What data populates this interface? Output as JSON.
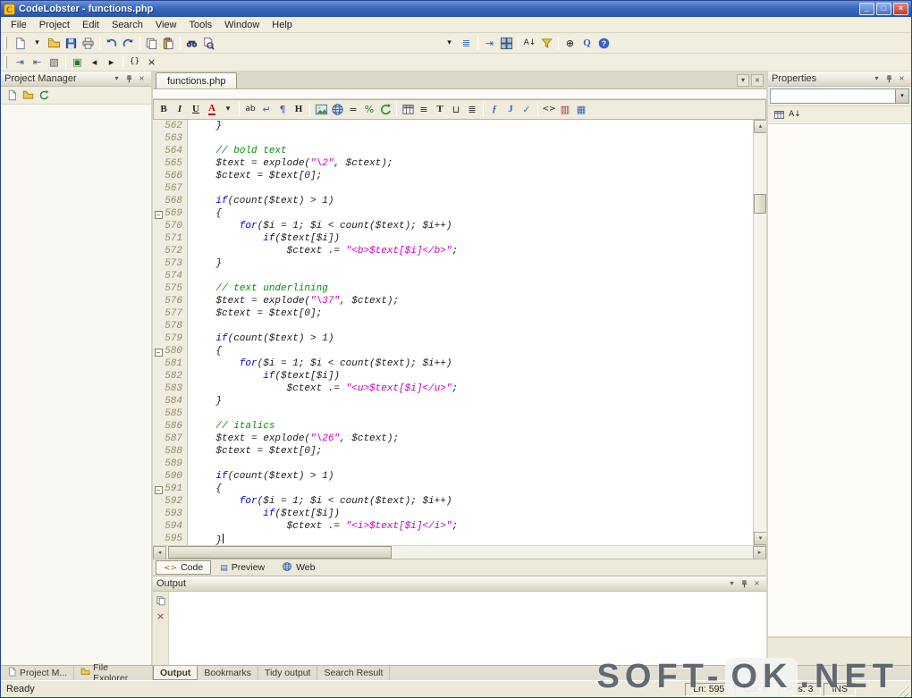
{
  "window": {
    "title": "CodeLobster - functions.php"
  },
  "titlebar": {
    "buttons": [
      {
        "name": "minimize-button",
        "glyph": "_"
      },
      {
        "name": "maximize-button",
        "glyph": "□"
      },
      {
        "name": "close-button",
        "glyph": "×"
      }
    ]
  },
  "menu": [
    "File",
    "Project",
    "Edit",
    "Search",
    "View",
    "Tools",
    "Window",
    "Help"
  ],
  "panel_buttons": [
    {
      "name": "panel-menu-icon",
      "icon": "chevron"
    },
    {
      "name": "panel-pin-icon",
      "icon": "pin"
    },
    {
      "name": "panel-close-icon",
      "icon": "close"
    }
  ],
  "toolbar_main": [
    {
      "grip": true
    },
    {
      "name": "new-file-icon",
      "icon": "page"
    },
    {
      "name": "new-file-dropdown-icon",
      "glyph": "▾",
      "gcls": "small"
    },
    {
      "name": "open-file-icon",
      "icon": "folder"
    },
    {
      "name": "save-icon",
      "icon": "disk"
    },
    {
      "name": "print-icon",
      "icon": "printer"
    },
    {
      "sep": true
    },
    {
      "name": "undo-icon",
      "icon": "undo"
    },
    {
      "name": "redo-icon",
      "icon": "redo"
    },
    {
      "sep": true
    },
    {
      "name": "copy-icon",
      "icon": "copy"
    },
    {
      "name": "paste-icon",
      "icon": "paste"
    },
    {
      "sep": true
    },
    {
      "name": "find-icon",
      "icon": "find"
    },
    {
      "name": "find-in-files-icon",
      "icon": "findfiles"
    },
    {
      "space": true
    },
    {
      "name": "toolbar-options-icon",
      "glyph": "▾",
      "gcls": "small"
    },
    {
      "name": "members-list-icon",
      "glyph": "≣",
      "color": "#3a62c0"
    },
    {
      "sep": true
    },
    {
      "name": "format-code-icon",
      "glyph": "⇥",
      "color": "#3a62c0"
    },
    {
      "name": "windows-icon",
      "icon": "windows"
    },
    {
      "sep": true
    },
    {
      "name": "sort-ascending-icon",
      "glyph": "A↓",
      "gcls": "small"
    },
    {
      "name": "filter-icon",
      "icon": "funnel"
    },
    {
      "sep": true
    },
    {
      "name": "zoom-icon",
      "glyph": "⊕"
    },
    {
      "name": "quick-search-icon",
      "glyph": "Q",
      "gcls": "fb",
      "color": "#3a62c0"
    },
    {
      "name": "help-icon",
      "icon": "help"
    }
  ],
  "toolbar_edit": [
    {
      "grip": true
    },
    {
      "name": "increase-indent-icon",
      "glyph": "⇥",
      "color": "#335a9a"
    },
    {
      "name": "decrease-indent-icon",
      "glyph": "⇤",
      "color": "#335a9a"
    },
    {
      "name": "comment-icon",
      "glyph": "▧",
      "color": "#556"
    },
    {
      "sep": true
    },
    {
      "name": "toggle-bookmark-icon",
      "glyph": "▣",
      "color": "#2a7a2a"
    },
    {
      "name": "prev-bookmark-icon",
      "glyph": "◂"
    },
    {
      "name": "next-bookmark-icon",
      "glyph": "▸"
    },
    {
      "sep": true
    },
    {
      "name": "match-brace-icon",
      "glyph": "{}",
      "gcls": "small"
    },
    {
      "name": "close-toolbar-icon",
      "glyph": "×"
    }
  ],
  "project_manager": {
    "title": "Project Manager",
    "toolbar": [
      {
        "name": "new-project-icon",
        "icon": "page"
      },
      {
        "name": "open-folder-icon",
        "icon": "folder"
      },
      {
        "name": "refresh-project-icon",
        "icon": "refresh"
      }
    ]
  },
  "properties": {
    "title": "Properties",
    "selector_value": "",
    "toolbar": [
      {
        "name": "categorized-icon",
        "icon": "table"
      },
      {
        "name": "sort-alphabetical-icon",
        "glyph": "A↓",
        "gcls": "small"
      }
    ]
  },
  "output": {
    "title": "Output",
    "strip": [
      {
        "name": "copy-output-icon",
        "icon": "copy"
      },
      {
        "name": "clear-output-icon",
        "glyph": "×",
        "color": "#a03030"
      }
    ]
  },
  "editor": {
    "tab": "functions.php",
    "tab_buttons": [
      {
        "name": "tab-scroll-icon",
        "icon": "chevron"
      },
      {
        "name": "tab-close-icon",
        "icon": "close"
      }
    ],
    "syntax_colors": {
      "p": "#1a1a1a",
      "k": "#0000cc",
      "c": "#009000",
      "s": "#c800c8"
    },
    "format_toolbar": [
      {
        "name": "bold-icon",
        "glyph": "B",
        "gcls": "fb"
      },
      {
        "name": "italic-icon",
        "glyph": "I",
        "gcls": "fi"
      },
      {
        "name": "underline-icon",
        "glyph": "U",
        "gcls": "fu"
      },
      {
        "name": "font-color-icon",
        "glyph": "A",
        "gcls": "fA"
      },
      {
        "name": "font-color-dropdown-icon",
        "glyph": "▾",
        "gcls": "small"
      },
      {
        "sep": true
      },
      {
        "name": "abbr-icon",
        "glyph": "ab",
        "gcls": "small"
      },
      {
        "name": "line-break-icon",
        "glyph": "↵",
        "color": "#3a62c0"
      },
      {
        "name": "paragraph-icon",
        "glyph": "¶",
        "color": "#3a62c0"
      },
      {
        "name": "heading-icon",
        "glyph": "H",
        "gcls": "fb"
      },
      {
        "sep": true
      },
      {
        "name": "image-icon",
        "icon": "image"
      },
      {
        "name": "hyperlink-icon",
        "icon": "globe"
      },
      {
        "name": "equals-icon",
        "glyph": "="
      },
      {
        "name": "percent-icon",
        "glyph": "%",
        "color": "#2a7a2a"
      },
      {
        "name": "refresh-icon",
        "icon": "refresh"
      },
      {
        "sep": true
      },
      {
        "name": "table-icon",
        "icon": "table"
      },
      {
        "name": "align-justify-icon",
        "glyph": "≡"
      },
      {
        "name": "text-icon",
        "glyph": "T",
        "gcls": "fb"
      },
      {
        "name": "nbsp-icon",
        "glyph": "⊔"
      },
      {
        "name": "list-icon",
        "glyph": "≣"
      },
      {
        "sep": true
      },
      {
        "name": "function-icon",
        "glyph": "ƒ",
        "color": "#3a62c0",
        "gcls": "fi"
      },
      {
        "name": "script-icon",
        "glyph": "J",
        "color": "#3a62c0",
        "gcls": "fb"
      },
      {
        "name": "spellcheck-icon",
        "glyph": "✓",
        "color": "#2a8a8a"
      },
      {
        "sep": true
      },
      {
        "name": "tag-edit-icon",
        "glyph": "<>",
        "gcls": "small"
      },
      {
        "name": "html-validate-icon",
        "glyph": "▥",
        "color": "#a03030"
      },
      {
        "name": "browser-preview-icon",
        "glyph": "▦",
        "color": "#3a62c0"
      }
    ],
    "mode_tabs": [
      {
        "label": "Code",
        "name": "mode-tab-code",
        "icon_name": "code-icon",
        "glyph": "<>",
        "color": "#b06020",
        "active": true
      },
      {
        "label": "Preview",
        "name": "mode-tab-preview",
        "icon_name": "preview-icon",
        "glyph": "▤",
        "color": "#3a62c0"
      },
      {
        "label": "Web",
        "name": "mode-tab-web",
        "icon_name": "web-icon",
        "icon": "globe"
      }
    ],
    "lines": [
      {
        "n": 562,
        "tk": [
          [
            "p",
            "    }"
          ]
        ]
      },
      {
        "n": 563,
        "tk": []
      },
      {
        "n": 564,
        "tk": [
          [
            "p",
            "    "
          ],
          [
            "c",
            "// bold text"
          ]
        ]
      },
      {
        "n": 565,
        "tk": [
          [
            "p",
            "    $text = explode("
          ],
          [
            "s",
            "\"\\2\""
          ],
          [
            "p",
            ", $ctext);"
          ]
        ]
      },
      {
        "n": 566,
        "tk": [
          [
            "p",
            "    $ctext = $text[0];"
          ]
        ]
      },
      {
        "n": 567,
        "tk": []
      },
      {
        "n": 568,
        "tk": [
          [
            "p",
            "    "
          ],
          [
            "k",
            "if"
          ],
          [
            "p",
            "(count($text) > 1)"
          ]
        ]
      },
      {
        "n": 569,
        "fold": true,
        "tk": [
          [
            "p",
            "    {"
          ]
        ]
      },
      {
        "n": 570,
        "tk": [
          [
            "p",
            "        "
          ],
          [
            "k",
            "for"
          ],
          [
            "p",
            "($i = 1; $i < count($text); $i++)"
          ]
        ]
      },
      {
        "n": 571,
        "tk": [
          [
            "p",
            "            "
          ],
          [
            "k",
            "if"
          ],
          [
            "p",
            "($text[$i])"
          ]
        ]
      },
      {
        "n": 572,
        "tk": [
          [
            "p",
            "                $ctext .= "
          ],
          [
            "s",
            "\"<b>$text[$i]</b>\""
          ],
          [
            "p",
            ";"
          ]
        ]
      },
      {
        "n": 573,
        "tk": [
          [
            "p",
            "    }"
          ]
        ]
      },
      {
        "n": 574,
        "tk": []
      },
      {
        "n": 575,
        "tk": [
          [
            "p",
            "    "
          ],
          [
            "c",
            "// text underlining"
          ]
        ]
      },
      {
        "n": 576,
        "tk": [
          [
            "p",
            "    $text = explode("
          ],
          [
            "s",
            "\"\\37\""
          ],
          [
            "p",
            ", $ctext);"
          ]
        ]
      },
      {
        "n": 577,
        "tk": [
          [
            "p",
            "    $ctext = $text[0];"
          ]
        ]
      },
      {
        "n": 578,
        "tk": []
      },
      {
        "n": 579,
        "tk": [
          [
            "p",
            "    "
          ],
          [
            "k",
            "if"
          ],
          [
            "p",
            "(count($text) > 1)"
          ]
        ]
      },
      {
        "n": 580,
        "fold": true,
        "tk": [
          [
            "p",
            "    {"
          ]
        ]
      },
      {
        "n": 581,
        "tk": [
          [
            "p",
            "        "
          ],
          [
            "k",
            "for"
          ],
          [
            "p",
            "($i = 1; $i < count($text); $i++)"
          ]
        ]
      },
      {
        "n": 582,
        "tk": [
          [
            "p",
            "            "
          ],
          [
            "k",
            "if"
          ],
          [
            "p",
            "($text[$i])"
          ]
        ]
      },
      {
        "n": 583,
        "tk": [
          [
            "p",
            "                $ctext .= "
          ],
          [
            "s",
            "\"<u>$text[$i]</u>\""
          ],
          [
            "p",
            ";"
          ]
        ]
      },
      {
        "n": 584,
        "tk": [
          [
            "p",
            "    }"
          ]
        ]
      },
      {
        "n": 585,
        "tk": []
      },
      {
        "n": 586,
        "tk": [
          [
            "p",
            "    "
          ],
          [
            "c",
            "// italics"
          ]
        ]
      },
      {
        "n": 587,
        "tk": [
          [
            "p",
            "    $text = explode("
          ],
          [
            "s",
            "\"\\26\""
          ],
          [
            "p",
            ", $ctext);"
          ]
        ]
      },
      {
        "n": 588,
        "tk": [
          [
            "p",
            "    $ctext = $text[0];"
          ]
        ]
      },
      {
        "n": 589,
        "tk": []
      },
      {
        "n": 590,
        "tk": [
          [
            "p",
            "    "
          ],
          [
            "k",
            "if"
          ],
          [
            "p",
            "(count($text) > 1)"
          ]
        ]
      },
      {
        "n": 591,
        "fold": true,
        "tk": [
          [
            "p",
            "    {"
          ]
        ]
      },
      {
        "n": 592,
        "tk": [
          [
            "p",
            "        "
          ],
          [
            "k",
            "for"
          ],
          [
            "p",
            "($i = 1; $i < count($text); $i++)"
          ]
        ]
      },
      {
        "n": 593,
        "tk": [
          [
            "p",
            "            "
          ],
          [
            "k",
            "if"
          ],
          [
            "p",
            "($text[$i])"
          ]
        ]
      },
      {
        "n": 594,
        "tk": [
          [
            "p",
            "                $ctext .= "
          ],
          [
            "s",
            "\"<i>$text[$i]</i>\""
          ],
          [
            "p",
            ";"
          ]
        ]
      },
      {
        "n": 595,
        "caret": true,
        "tk": [
          [
            "p",
            "    }"
          ]
        ]
      }
    ]
  },
  "bottom_tabs": {
    "left": [
      {
        "label": "Project M...",
        "name": "tab-project-manager",
        "icon": "page",
        "icon_name": "project-icon"
      },
      {
        "label": "File Explorer",
        "name": "tab-file-explorer",
        "icon": "folder",
        "icon_name": "folder-icon"
      }
    ],
    "panels": [
      {
        "label": "Output",
        "name": "tab-output",
        "active": true
      },
      {
        "label": "Bookmarks",
        "name": "tab-bookmarks"
      },
      {
        "label": "Tidy output",
        "name": "tab-tidy-output"
      },
      {
        "label": "Search Result",
        "name": "tab-search-result"
      }
    ]
  },
  "status": {
    "ready": "Ready",
    "line": "Ln: 595",
    "col": "Col: 6",
    "pos": "Pos: 3",
    "mode": "INS"
  },
  "watermark": {
    "part1": "SOFT-",
    "part2": "OK",
    "part3": ".NET"
  }
}
